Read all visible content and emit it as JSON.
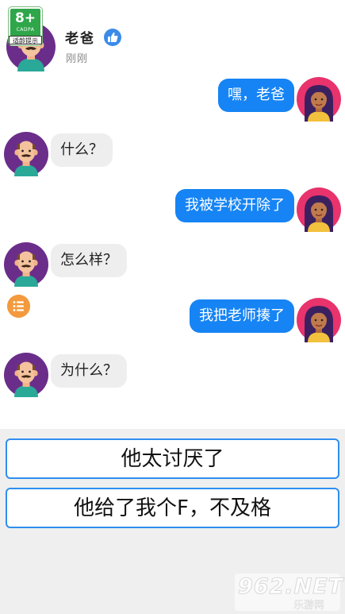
{
  "header": {
    "contact_name": "老爸",
    "status": "刚刚",
    "age_badge": {
      "rating": "8+",
      "org": "CADPA",
      "tip": "适龄提示"
    }
  },
  "messages": [
    {
      "from": "player",
      "text": "嘿，老爸"
    },
    {
      "from": "dad",
      "text": "什么？"
    },
    {
      "from": "player",
      "text": "我被学校开除了"
    },
    {
      "from": "dad",
      "text": "怎么样？"
    },
    {
      "from": "player",
      "text": "我把老师揍了"
    },
    {
      "from": "dad",
      "text": "为什么？"
    }
  ],
  "choices": [
    {
      "label": "他太讨厌了"
    },
    {
      "label": "他给了我个F，不及格"
    }
  ],
  "watermark": {
    "main": "962.NET",
    "sub": "乐游网"
  },
  "colors": {
    "outgoing_bubble": "#1684f4",
    "incoming_bubble": "#eeeeee",
    "choice_border": "#2f8ef0",
    "dad_avatar_bg": "#6b2d8a",
    "player_avatar_bg": "#e8336c",
    "menu_button": "#f39a3e",
    "age_badge": "#2fa64a"
  },
  "icons": [
    "like-icon",
    "menu-icon",
    "dad-avatar",
    "player-avatar"
  ]
}
